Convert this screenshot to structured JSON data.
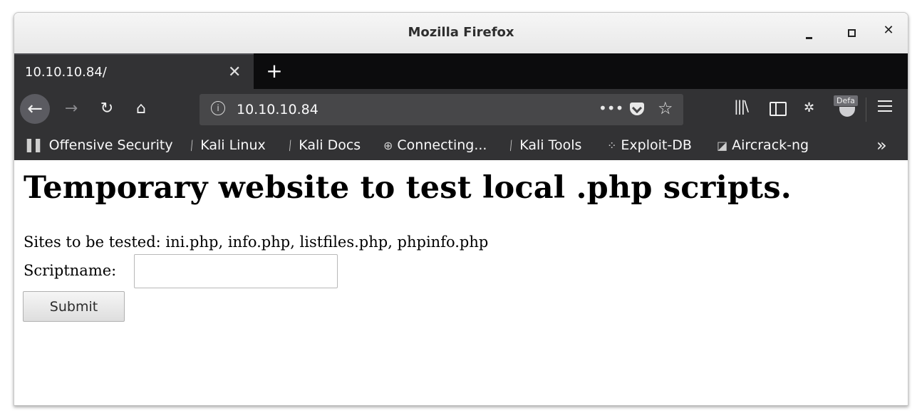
{
  "window": {
    "title": "Mozilla Firefox"
  },
  "tabs": [
    {
      "label": "10.10.10.84/"
    }
  ],
  "nav": {
    "url": "10.10.10.84",
    "addon_badge": "Defa"
  },
  "bookmarks": [
    {
      "label": "Offensive Security",
      "icon": "offsec-icon"
    },
    {
      "label": "Kali Linux",
      "icon": "kali-dragon-icon"
    },
    {
      "label": "Kali Docs",
      "icon": "kali-dragon-icon"
    },
    {
      "label": "Connecting...",
      "icon": "globe-icon"
    },
    {
      "label": "Kali Tools",
      "icon": "kali-dragon-icon"
    },
    {
      "label": "Exploit-DB",
      "icon": "exploit-db-icon"
    },
    {
      "label": "Aircrack-ng",
      "icon": "aircrack-icon"
    }
  ],
  "page": {
    "heading": "Temporary website to test local .php scripts.",
    "sites_text": "Sites to be tested: ini.php, info.php, listfiles.php, phpinfo.php",
    "scriptname_label": "Scriptname:",
    "scriptname_value": "",
    "submit_label": "Submit"
  }
}
